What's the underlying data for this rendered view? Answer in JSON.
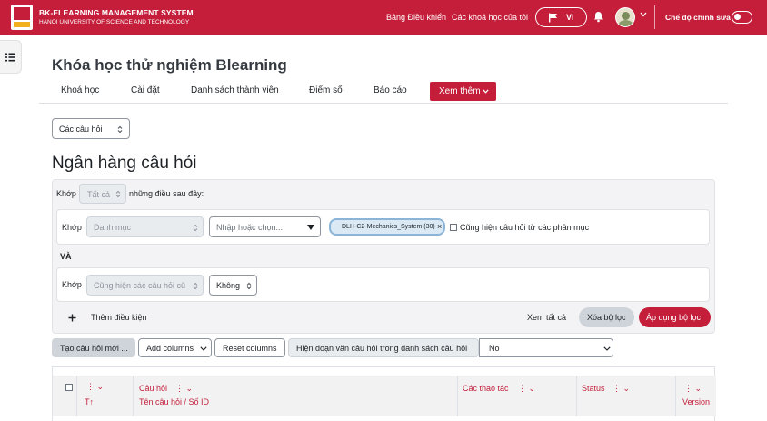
{
  "header": {
    "brand_line1": "BK-ELEARNING MANAGEMENT SYSTEM",
    "brand_line2": "HANOI UNIVERSITY OF SCIENCE AND TECHNOLOGY",
    "nav_dashboard": "Bảng Điều khiển",
    "nav_my_courses": "Các khoá học của tôi",
    "language": "VI",
    "edit_mode_label": "Chế độ chỉnh sửa"
  },
  "course": {
    "title": "Khóa học thử nghiệm Blearning",
    "tabs": [
      {
        "label": "Khoá học"
      },
      {
        "label": "Cài đặt"
      },
      {
        "label": "Danh sách thành viên"
      },
      {
        "label": "Điểm số"
      },
      {
        "label": "Báo cáo"
      }
    ],
    "more_label": "Xem thêm"
  },
  "nav_select": "Các câu hỏi",
  "page_title": "Ngân hàng câu hỏi",
  "filters": {
    "match_label": "Khớp",
    "match_all_value": "Tất cả",
    "match_suffix": "những điều sau đây:",
    "condition1": {
      "match_label": "Khớp",
      "type_value": "Danh mục",
      "search_placeholder": "Nhập hoặc chọn...",
      "chip_text": "DLH-C2-Mechanics_System (30)",
      "chip_remove": "×",
      "subcategories_label": "Cũng hiện câu hỏi từ các phân mục"
    },
    "and_label": "VÀ",
    "condition2": {
      "match_label": "Khớp",
      "type_value": "Cũng hiện các câu hỏi cũ",
      "value": "Không"
    },
    "add_condition": "Thêm điều kiện",
    "view_all": "Xem tất cả",
    "clear": "Xóa bộ lọc",
    "apply": "Áp dụng bộ lọc"
  },
  "toolbar": {
    "create_question": "Tạo câu hỏi mới ...",
    "add_columns": "Add columns",
    "reset_columns": "Reset columns",
    "show_text_label": "Hiện đoạn văn câu hỏi trong danh sách câu hỏi",
    "show_text_value": "No"
  },
  "table": {
    "sort_type_label": "T↑",
    "question_header": "Câu hỏi",
    "question_subheader": "Tên câu hỏi / Số ID",
    "actions_header": "Các thao tác",
    "status_header": "Status",
    "version_header": "Version"
  },
  "colors": {
    "brand": "#c41e3a",
    "clear_button_bg": "#ced4da",
    "chip_bg": "#dbe9f5"
  }
}
